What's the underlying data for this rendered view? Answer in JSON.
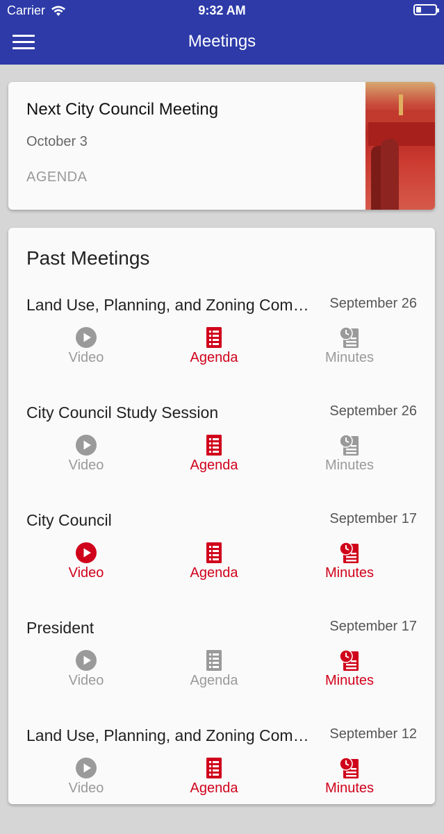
{
  "status_bar": {
    "carrier": "Carrier",
    "time": "9:32 AM"
  },
  "nav": {
    "title": "Meetings",
    "menu_icon": "hamburger-menu-icon"
  },
  "next_meeting": {
    "title": "Next City Council Meeting",
    "date": "October 3",
    "agenda_label": "AGENDA"
  },
  "past": {
    "title": "Past Meetings",
    "labels": {
      "video": "Video",
      "agenda": "Agenda",
      "minutes": "Minutes"
    },
    "meetings": [
      {
        "name": "Land Use, Planning, and Zoning Committee",
        "date": "September 26",
        "video": false,
        "agenda": true,
        "minutes": false
      },
      {
        "name": "City Council Study Session",
        "date": "September 26",
        "video": false,
        "agenda": true,
        "minutes": false
      },
      {
        "name": "City Council",
        "date": "September 17",
        "video": true,
        "agenda": true,
        "minutes": true
      },
      {
        "name": "President",
        "date": "September 17",
        "video": false,
        "agenda": false,
        "minutes": true
      },
      {
        "name": "Land Use, Planning, and Zoning Committee",
        "date": "September 12",
        "video": false,
        "agenda": true,
        "minutes": true
      }
    ]
  },
  "colors": {
    "brand": "#2d3aa8",
    "active": "#d0021b",
    "inactive": "#9a9a9a"
  },
  "icons": {
    "video": "play-circle-icon",
    "agenda": "document-list-icon",
    "minutes": "clock-document-icon"
  }
}
